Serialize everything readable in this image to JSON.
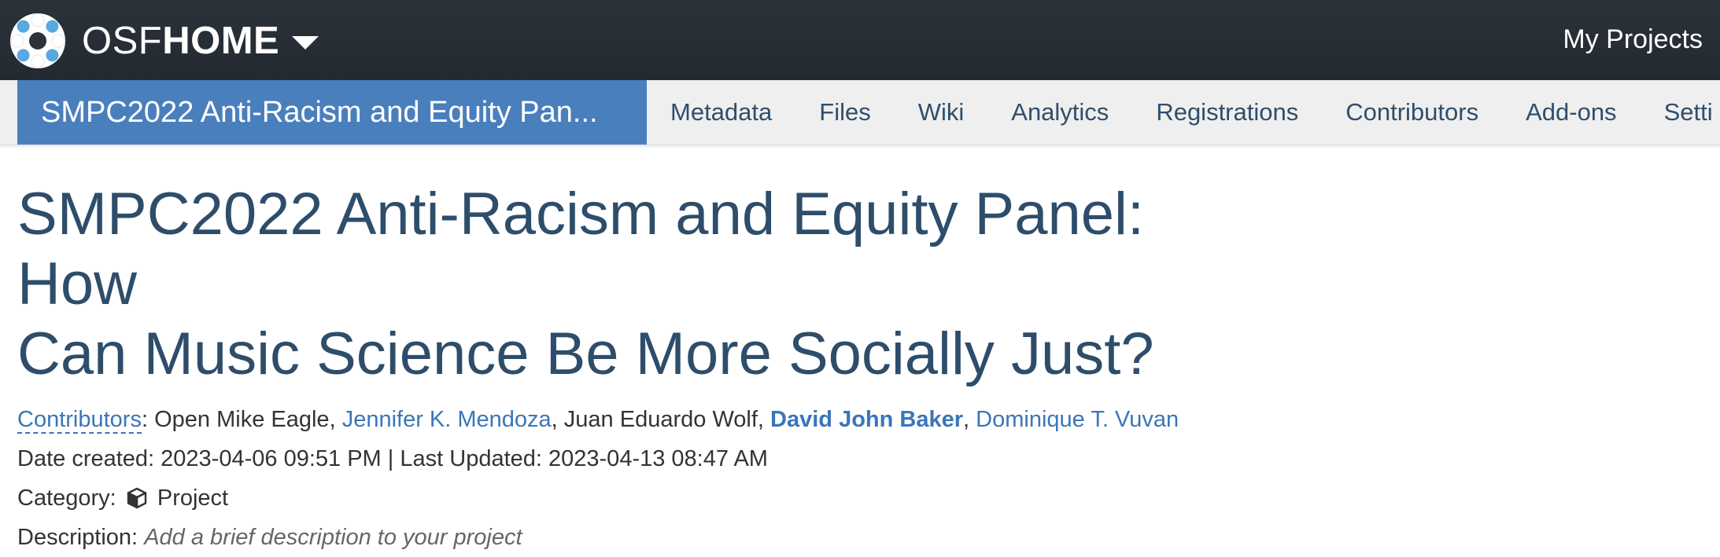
{
  "navbar": {
    "brand_osf": "OSF",
    "brand_home": "HOME",
    "my_projects": "My Projects"
  },
  "project_nav": {
    "project_title": "SMPC2022 Anti-Racism and Equity Pan...",
    "items": [
      {
        "label": "Metadata"
      },
      {
        "label": "Files"
      },
      {
        "label": "Wiki"
      },
      {
        "label": "Analytics"
      },
      {
        "label": "Registrations"
      },
      {
        "label": "Contributors"
      },
      {
        "label": "Add-ons"
      },
      {
        "label": "Setti"
      }
    ]
  },
  "project": {
    "title_line1": "SMPC2022 Anti-Racism and Equity Panel: How",
    "title_line2": "Can Music Science Be More Socially Just?",
    "contributors_label": "Contributors",
    "contributors": [
      {
        "name": "Open Mike Eagle",
        "link": false,
        "bold": false
      },
      {
        "name": "Jennifer K. Mendoza",
        "link": true,
        "bold": false
      },
      {
        "name": "Juan Eduardo Wolf",
        "link": false,
        "bold": false
      },
      {
        "name": "David John Baker",
        "link": true,
        "bold": true
      },
      {
        "name": "Dominique T. Vuvan",
        "link": true,
        "bold": false
      }
    ],
    "date_created_label": "Date created:",
    "date_created": "2023-04-06 09:51 PM",
    "separator": "|",
    "last_updated_label": "Last Updated:",
    "last_updated": "2023-04-13 08:47 AM",
    "category_label": "Category:",
    "category_icon": "cube-icon",
    "category": "Project",
    "description_label": "Description:",
    "description_placeholder": "Add a brief description to your project"
  }
}
